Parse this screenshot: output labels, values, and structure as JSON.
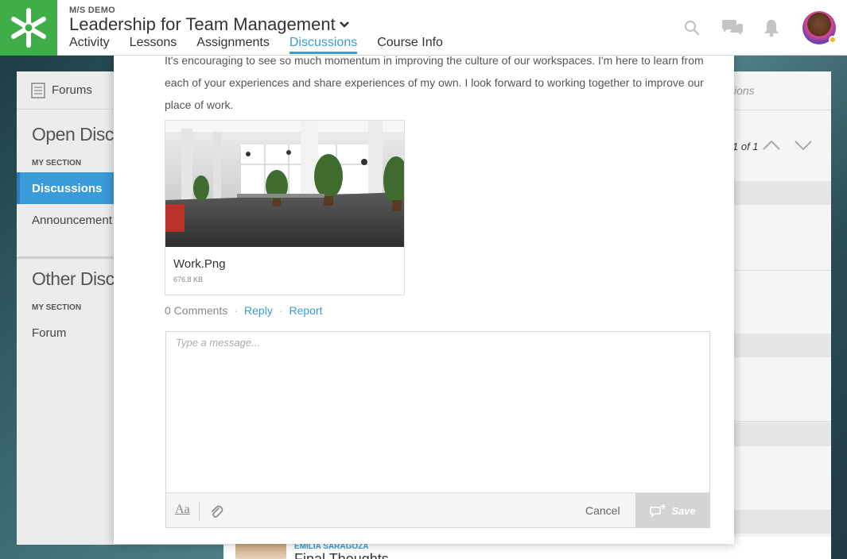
{
  "header": {
    "org": "M/S DEMO",
    "course_title": "Leadership for Team Management",
    "nav": [
      "Activity",
      "Lessons",
      "Assignments",
      "Discussions",
      "Course Info"
    ],
    "active_nav": "Discussions",
    "brand_color": "#3fae49",
    "accent_color": "#3a9bd9"
  },
  "sidebar": {
    "forums_label": "Forums",
    "open_heading": "Open Discuss",
    "open_section": "MY SECTION",
    "open_items": [
      "Discussions",
      "Announcement"
    ],
    "other_heading": "Other Discuss",
    "other_section": "MY SECTION",
    "other_items": [
      "Forum"
    ]
  },
  "right_strip": {
    "tab_text": "ions",
    "pager": "1 of 1"
  },
  "post": {
    "text": "It's encouraging to see so much momentum in improving the culture of our workspaces. I'm here to learn from each of your experiences and share experiences of my own. I look forward to working together to improve our place of work.",
    "attachment": {
      "name": "Work.Png",
      "size": "676.8 KB"
    },
    "comments": "0 Comments",
    "reply": "Reply",
    "report": "Report"
  },
  "composer": {
    "placeholder": "Type a message...",
    "format_label": "Aa",
    "cancel": "Cancel",
    "save": "Save"
  },
  "background_post": {
    "author": "EMILIA SARAGOZA",
    "title": "Final Thoughts"
  }
}
